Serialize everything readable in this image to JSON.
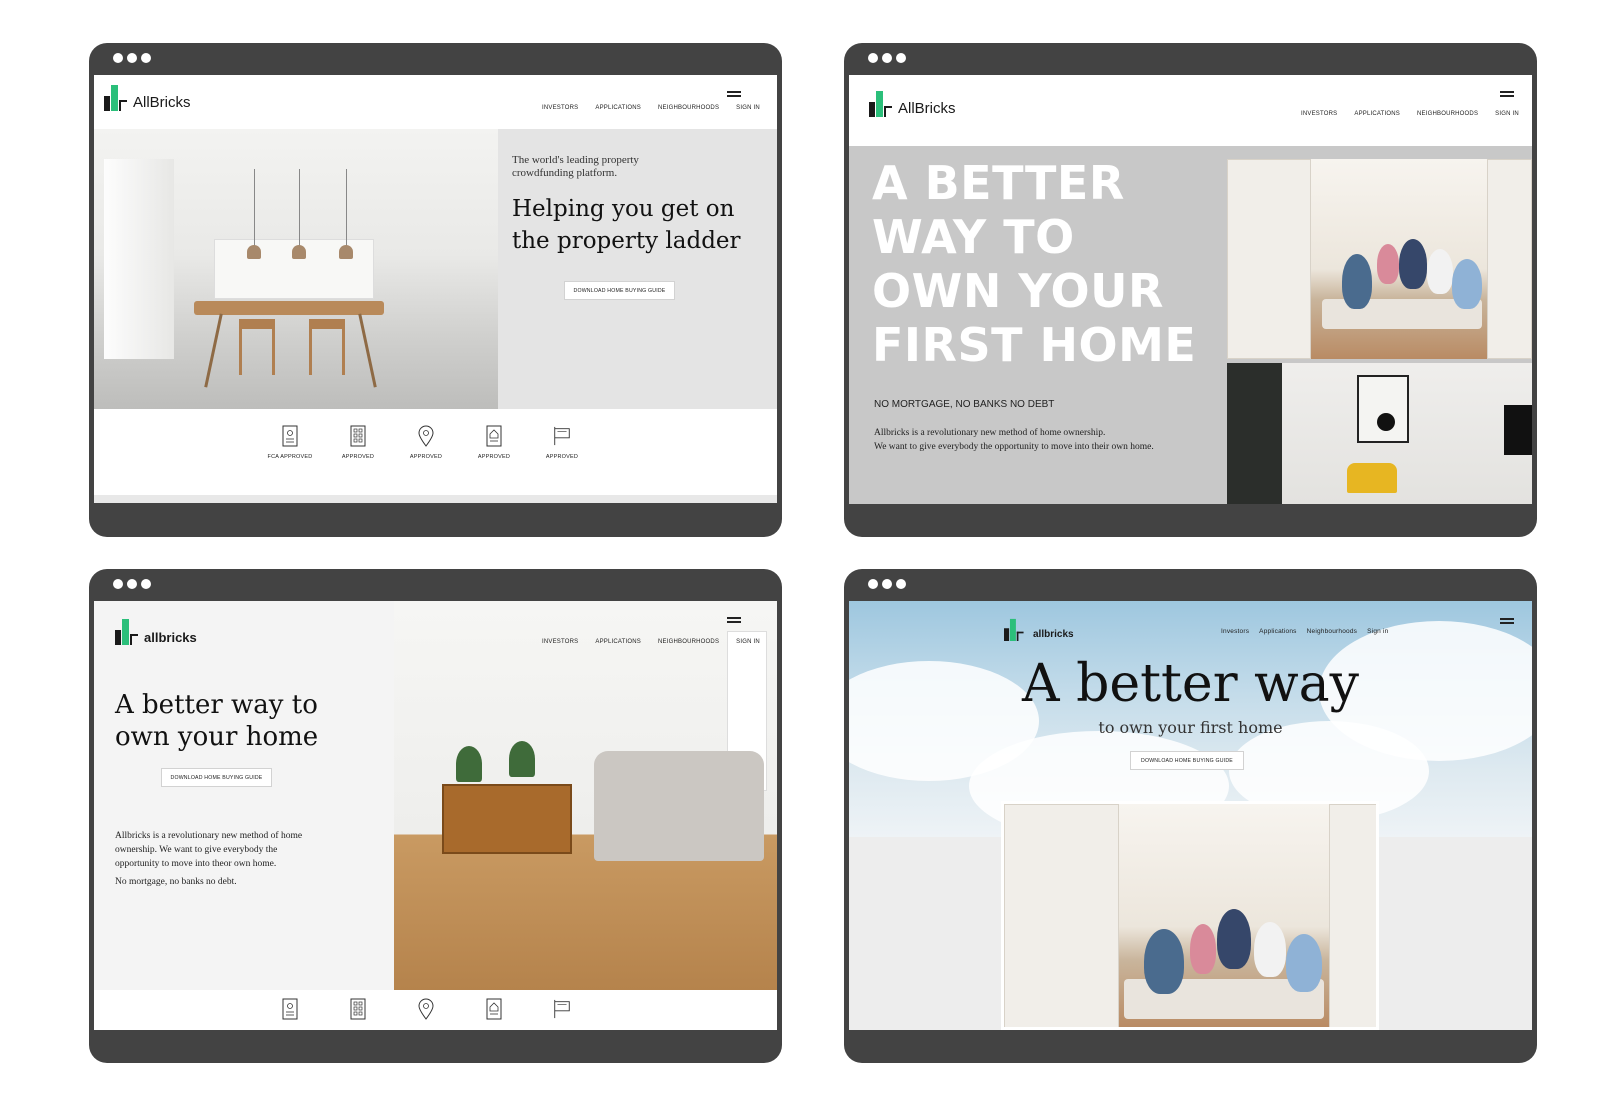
{
  "brand": {
    "name_caps": "AllBricks",
    "name_lower": "allbricks",
    "green": "#2bbf7a",
    "frame_color": "#434343"
  },
  "nav_upper": [
    "INVESTORS",
    "APPLICATIONS",
    "NEIGHBOURHOODS",
    "SIGN IN"
  ],
  "nav_lower": [
    "Investors",
    "Applications",
    "Neighbourhoods",
    "Sign in"
  ],
  "mockup1": {
    "tagline": "The world's leading property crowdfunding platform.",
    "heading": "Helping you get on the property ladder",
    "button": "DOWNLOAD HOME BUYING GUIDE",
    "features": [
      {
        "icon": "document-icon",
        "label": "FCA APPROVED"
      },
      {
        "icon": "building-icon",
        "label": "APPROVED"
      },
      {
        "icon": "location-pin-icon",
        "label": "APPROVED"
      },
      {
        "icon": "house-document-icon",
        "label": "APPROVED"
      },
      {
        "icon": "flag-icon",
        "label": "APPROVED"
      }
    ]
  },
  "mockup2": {
    "heading_lines": [
      "A BETTER",
      "WAY TO",
      "OWN YOUR",
      "FIRST HOME"
    ],
    "subheading": "NO MORTGAGE, NO BANKS NO DEBT",
    "body_lines": [
      "Allbricks is a revolutionary new method of home ownership.",
      "We want to give everybody the opportunity to move into their own home."
    ]
  },
  "mockup3": {
    "heading_lines": [
      "A better way to",
      "own your home"
    ],
    "button": "DOWNLOAD HOME BUYING GUIDE",
    "body_lines": [
      "Allbricks is a revolutionary new method of home",
      "ownership. We want to give everybody the",
      "opportunity to move into theor own home."
    ],
    "note": "No mortgage, no banks no debt.",
    "feature_icons": [
      "document-icon",
      "building-icon",
      "location-pin-icon",
      "house-document-icon",
      "flag-icon"
    ]
  },
  "mockup4": {
    "heading": "A better way",
    "subheading": "to own your first home",
    "button": "DOWNLOAD HOME BUYING GUIDE"
  }
}
